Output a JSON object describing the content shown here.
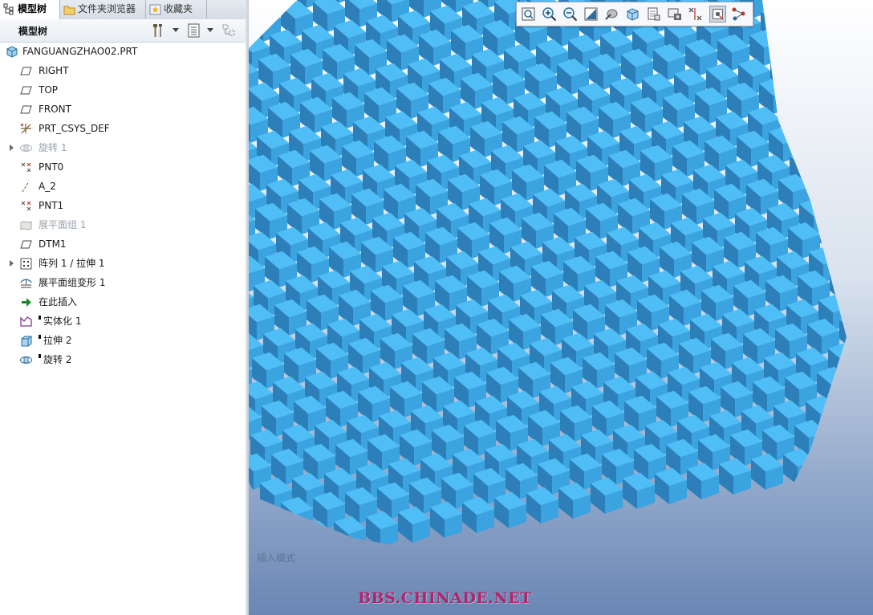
{
  "tabs": [
    {
      "label": "模型树",
      "icon": "model-tree-icon",
      "active": true
    },
    {
      "label": "文件夹浏览器",
      "icon": "folder-browser-icon",
      "active": false
    },
    {
      "label": "收藏夹",
      "icon": "favorites-icon",
      "active": false
    }
  ],
  "tree_toolbar": {
    "title": "模型树",
    "settings_icon": "tools-icon",
    "show_icon": "tree-columns-icon",
    "filter_icon": "tree-filter-icon"
  },
  "tree": {
    "root": {
      "label": "FANGUANGZHAO02.PRT",
      "icon": "part-icon"
    },
    "items": [
      {
        "label": "RIGHT",
        "icon": "datum-plane-icon",
        "expandable": false,
        "dim": false
      },
      {
        "label": "TOP",
        "icon": "datum-plane-icon",
        "expandable": false,
        "dim": false
      },
      {
        "label": "FRONT",
        "icon": "datum-plane-icon",
        "expandable": false,
        "dim": false
      },
      {
        "label": "PRT_CSYS_DEF",
        "icon": "csys-icon",
        "expandable": false,
        "dim": false
      },
      {
        "label": "旋转 1",
        "icon": "revolve-icon",
        "expandable": true,
        "dim": true
      },
      {
        "label": "PNT0",
        "icon": "datum-point-icon",
        "expandable": false,
        "dim": false
      },
      {
        "label": "A_2",
        "icon": "datum-axis-icon",
        "expandable": false,
        "dim": false
      },
      {
        "label": "PNT1",
        "icon": "datum-point-icon",
        "expandable": false,
        "dim": false
      },
      {
        "label": "展平面组 1",
        "icon": "flatten-quilt-icon",
        "expandable": false,
        "dim": true
      },
      {
        "label": "DTM1",
        "icon": "datum-plane-icon",
        "expandable": false,
        "dim": false
      },
      {
        "label": "阵列 1 / 拉伸 1",
        "icon": "pattern-icon",
        "expandable": true,
        "dim": false
      },
      {
        "label": "展平面组变形 1",
        "icon": "flatten-deform-icon",
        "expandable": false,
        "dim": false
      },
      {
        "label": "在此插入",
        "icon": "insert-here-arrow-icon",
        "expandable": false,
        "dim": false
      },
      {
        "label": "实体化 1",
        "icon": "solidify-icon",
        "expandable": false,
        "dim": false,
        "marker": true
      },
      {
        "label": "拉伸 2",
        "icon": "extrude-icon",
        "expandable": false,
        "dim": false,
        "marker": true
      },
      {
        "label": "旋转 2",
        "icon": "revolve-icon",
        "expandable": false,
        "dim": false,
        "marker": true
      }
    ]
  },
  "view_toolbar": {
    "buttons": [
      "refit-icon",
      "zoom-in-icon",
      "zoom-out-icon",
      "repaint-icon",
      "display-style-icon",
      "saved-views-icon",
      "layers-icon",
      "view-manager-icon",
      "datum-display-icon",
      "spin-center-icon",
      "annotation-display-icon"
    ]
  },
  "graphics": {
    "model_color": "#44b6f2",
    "watermark": "BBS.CHINADE.NET",
    "status_text": "插入模式"
  }
}
